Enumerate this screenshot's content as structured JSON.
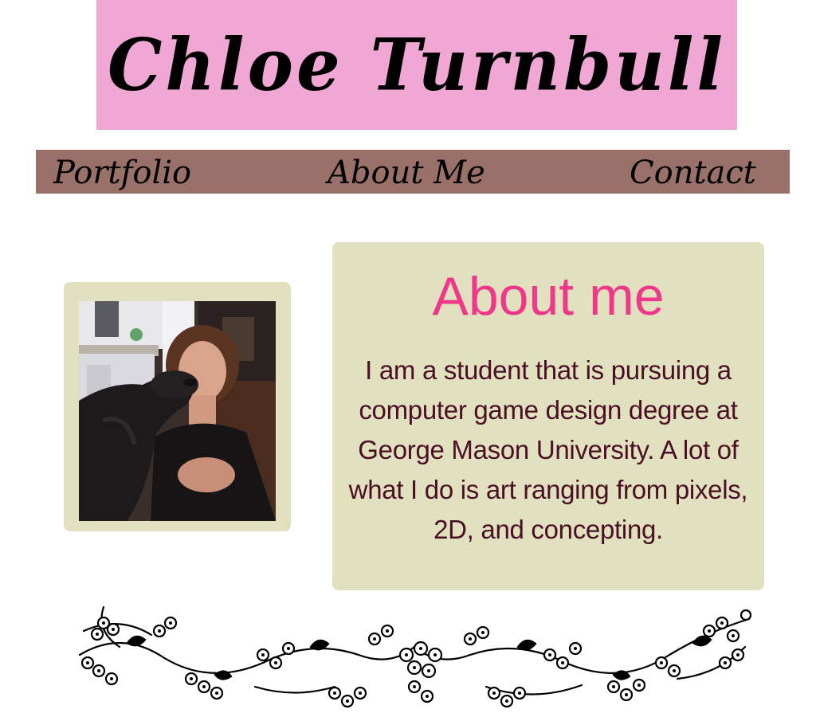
{
  "header": {
    "title": "Chloe Turnbull"
  },
  "nav": {
    "items": [
      {
        "label": "Portfolio"
      },
      {
        "label": "About Me"
      },
      {
        "label": "Contact"
      }
    ]
  },
  "about": {
    "heading": "About me",
    "body": "I am a student that is pursuing a computer game design degree at George Mason University. A lot of what I do is art ranging from pixels, 2D, and concepting."
  },
  "colors": {
    "title_banner": "#f1a7d3",
    "nav_bar": "#9a7168",
    "card_background": "#e1e1bf",
    "heading_pink": "#f0388a",
    "body_text": "#4a0f24"
  }
}
